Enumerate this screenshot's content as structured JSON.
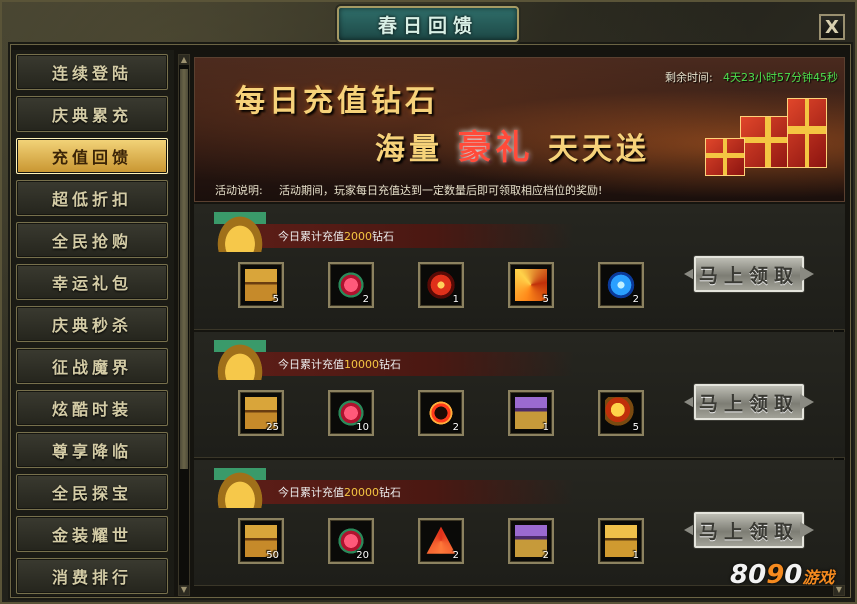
{
  "window": {
    "title": "春日回馈",
    "close_label": "X"
  },
  "sidebar": {
    "items": [
      {
        "label": "连续登陆",
        "active": false
      },
      {
        "label": "庆典累充",
        "active": false
      },
      {
        "label": "充值回馈",
        "active": true
      },
      {
        "label": "超低折扣",
        "active": false
      },
      {
        "label": "全民抢购",
        "active": false
      },
      {
        "label": "幸运礼包",
        "active": false
      },
      {
        "label": "庆典秒杀",
        "active": false
      },
      {
        "label": "征战魔界",
        "active": false
      },
      {
        "label": "炫酷时装",
        "active": false
      },
      {
        "label": "尊享降临",
        "active": false
      },
      {
        "label": "全民探宝",
        "active": false
      },
      {
        "label": "金装耀世",
        "active": false
      },
      {
        "label": "消费排行",
        "active": false
      }
    ]
  },
  "banner": {
    "headline_1": "每日充值钻石",
    "headline_2_prefix": "海量",
    "headline_2_highlight": "豪礼",
    "headline_2_suffix": "天天送",
    "timer_label": "剩余时间:",
    "timer_value": "4天23小时57分钟45秒",
    "desc_label": "活动说明:",
    "desc_text": "活动期间，玩家每日充值达到一定数量后即可领取相应档位的奖励!"
  },
  "rewards": [
    {
      "prefix": "今日累计充值",
      "amount": "2000",
      "suffix": "钻石",
      "claim_label": "马上领取",
      "items": [
        {
          "icon": "treasure-chest",
          "qty": "5"
        },
        {
          "icon": "red-gem-ring",
          "qty": "2"
        },
        {
          "icon": "fire-orb",
          "qty": "1"
        },
        {
          "icon": "flame-wings",
          "qty": "5"
        },
        {
          "icon": "blue-crystal",
          "qty": "2"
        }
      ]
    },
    {
      "prefix": "今日累计充值",
      "amount": "10000",
      "suffix": "钻石",
      "claim_label": "马上领取",
      "items": [
        {
          "icon": "treasure-chest",
          "qty": "25"
        },
        {
          "icon": "red-gem-ring",
          "qty": "10"
        },
        {
          "icon": "red-ring",
          "qty": "2"
        },
        {
          "icon": "jewel-chest",
          "qty": "1"
        },
        {
          "icon": "golden-dragon",
          "qty": "5"
        }
      ]
    },
    {
      "prefix": "今日累计充值",
      "amount": "20000",
      "suffix": "钻石",
      "claim_label": "马上领取",
      "items": [
        {
          "icon": "treasure-chest",
          "qty": "50"
        },
        {
          "icon": "red-gem-ring",
          "qty": "20"
        },
        {
          "icon": "red-triangle-rune",
          "qty": "2"
        },
        {
          "icon": "jewel-chest",
          "qty": "2"
        },
        {
          "icon": "gold-chest",
          "qty": "1"
        }
      ]
    }
  ],
  "watermark": {
    "digits_1": "8",
    "digits_2": "0",
    "digits_3": "9",
    "digits_4": "0",
    "cn": "游戏"
  },
  "colors": {
    "accent_gold": "#f5c542",
    "timer_green": "#4de04d",
    "active_tab": "#e8b84e"
  }
}
